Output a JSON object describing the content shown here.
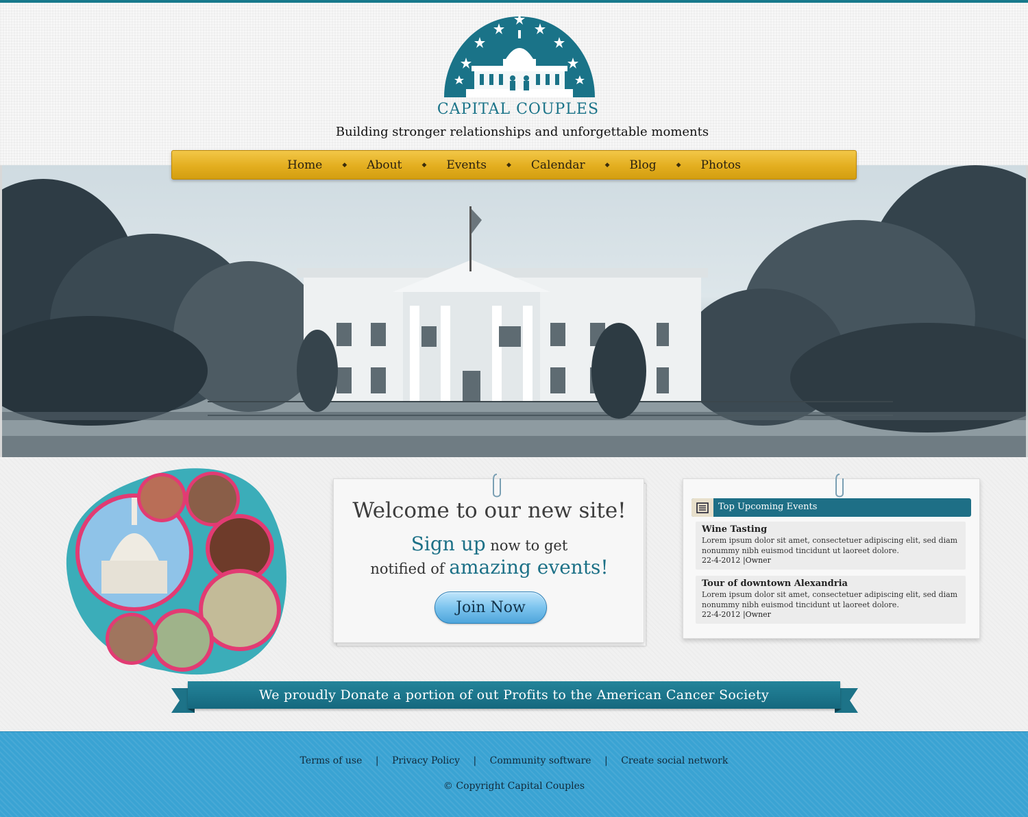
{
  "brand": {
    "name": "CAPITAL COUPLES",
    "tagline": "Building stronger relationships and unforgettable moments",
    "colors": {
      "teal": "#1a7388",
      "gold": "#e3ae1f",
      "sky": "#3aa3d3"
    }
  },
  "nav": {
    "items": [
      {
        "label": "Home"
      },
      {
        "label": "About"
      },
      {
        "label": "Events"
      },
      {
        "label": "Calendar"
      },
      {
        "label": "Blog"
      },
      {
        "label": "Photos"
      }
    ],
    "separator": "◆"
  },
  "welcome": {
    "title": "Welcome to our new site!",
    "signup_accent": "Sign up",
    "signup_rest": "now to get",
    "line2_pre": "notified of",
    "line2_accent": "amazing events",
    "line2_post": "!",
    "join_label": "Join Now"
  },
  "events": {
    "header": "Top Upcoming Events",
    "header_icon": "newspaper-icon",
    "items": [
      {
        "title": "Wine Tasting",
        "description": "Lorem ipsum dolor sit amet, consectetuer adipiscing elit, sed diam nonummy nibh euismod tincidunt ut laoreet dolore.",
        "date": "22-4-2012",
        "author": "Owner"
      },
      {
        "title": "Tour of downtown Alexandria",
        "description": "Lorem ipsum dolor sit amet, consectetuer adipiscing elit, sed diam nonummy nibh euismod tincidunt ut laoreet dolore.",
        "date": "22-4-2012",
        "author": "Owner"
      }
    ]
  },
  "donation_banner": "We proudly Donate a portion of out Profits to the American Cancer Society",
  "footer": {
    "links": [
      "Terms of use",
      "Privacy Policy",
      "Community software",
      "Create social network"
    ],
    "separator": "|",
    "copyright": "© Copyright Capital Couples"
  }
}
